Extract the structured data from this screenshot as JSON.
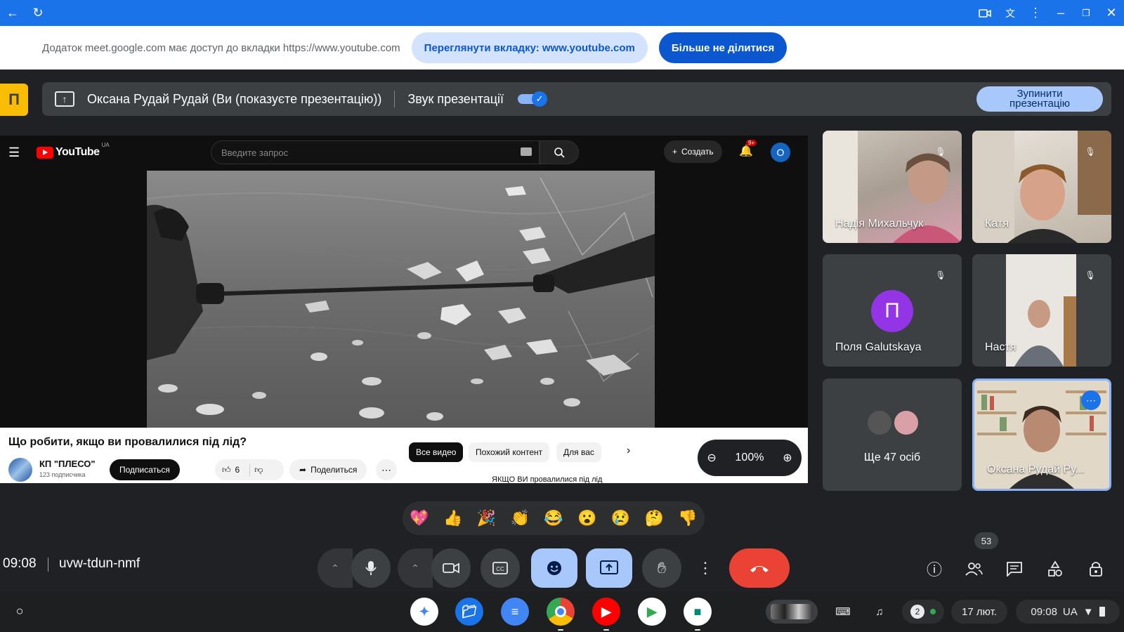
{
  "browser": {
    "back_icon": "arrow-left-icon",
    "reload_icon": "reload-icon"
  },
  "share_banner": {
    "message": "Додаток meet.google.com має доступ до вкладки https://www.youtube.com",
    "view_tab_label": "Переглянути вкладку: www.youtube.com",
    "stop_sharing_label": "Більше не ділитися"
  },
  "present_bar": {
    "presenter_label": "Оксана Рудай Рудай (Ви (показуєте презентацію))",
    "audio_label": "Звук презентації",
    "audio_on": true,
    "stop_label": "Зупинити презентацію"
  },
  "youtube": {
    "logo_text": "YouTube",
    "region": "UA",
    "search_placeholder": "Введите запрос",
    "create_label": "Создать",
    "notifications_badge": "9+",
    "avatar_letter": "О",
    "video_title": "Що робити, якщо ви провалилися під лід?",
    "channel_name": "КП \"ПЛЕСО\"",
    "channel_subs": "123 подписчика",
    "subscribe_label": "Подписаться",
    "likes": "6",
    "share_label": "Поделиться",
    "chips": [
      "Все видео",
      "Похожий контент",
      "Для вас"
    ],
    "next_video_title": "ЯКЩО ВИ провалилися під лід"
  },
  "zoom": {
    "value": "100%"
  },
  "participants": [
    {
      "name": "Надія Михальчук",
      "muted": true
    },
    {
      "name": "Катя",
      "muted": true
    },
    {
      "name": "Поля Galutskaya",
      "initial": "П",
      "muted": true
    },
    {
      "name": "Настя",
      "muted": true
    },
    {
      "name": "Ще 47 осіб"
    },
    {
      "name": "Оксана Рудай Ру..."
    }
  ],
  "reactions": [
    "💖",
    "👍",
    "🎉",
    "👏",
    "😂",
    "😮",
    "😢",
    "🤔",
    "👎"
  ],
  "meet_bar": {
    "time": "09:08",
    "meeting_code": "uvw-tdun-nmf",
    "people_count": "53"
  },
  "shelf": {
    "notifications_count": "2",
    "date": "17 лют.",
    "time": "09:08",
    "layout": "UA"
  },
  "colors": {
    "meet_bg": "#202124",
    "accent": "#1a73e8",
    "end_call": "#ea4335"
  }
}
